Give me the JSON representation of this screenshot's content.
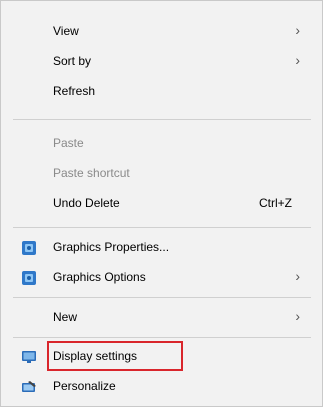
{
  "menu": {
    "items": [
      {
        "label": "View"
      },
      {
        "label": "Sort by"
      },
      {
        "label": "Refresh"
      },
      {
        "label": "Paste"
      },
      {
        "label": "Paste shortcut"
      },
      {
        "label": "Undo Delete",
        "shortcut": "Ctrl+Z"
      },
      {
        "label": "Graphics Properties..."
      },
      {
        "label": "Graphics Options"
      },
      {
        "label": "New"
      },
      {
        "label": "Display settings"
      },
      {
        "label": "Personalize"
      }
    ]
  },
  "icons": {
    "chevron": "chevron-right-icon",
    "graphics": "intel-graphics-icon",
    "display": "monitor-icon",
    "personalize": "personalize-icon"
  },
  "colors": {
    "highlight_box": "#d9262c",
    "menu_bg": "#f2f2f2",
    "disabled_text": "#8a8a8a"
  }
}
